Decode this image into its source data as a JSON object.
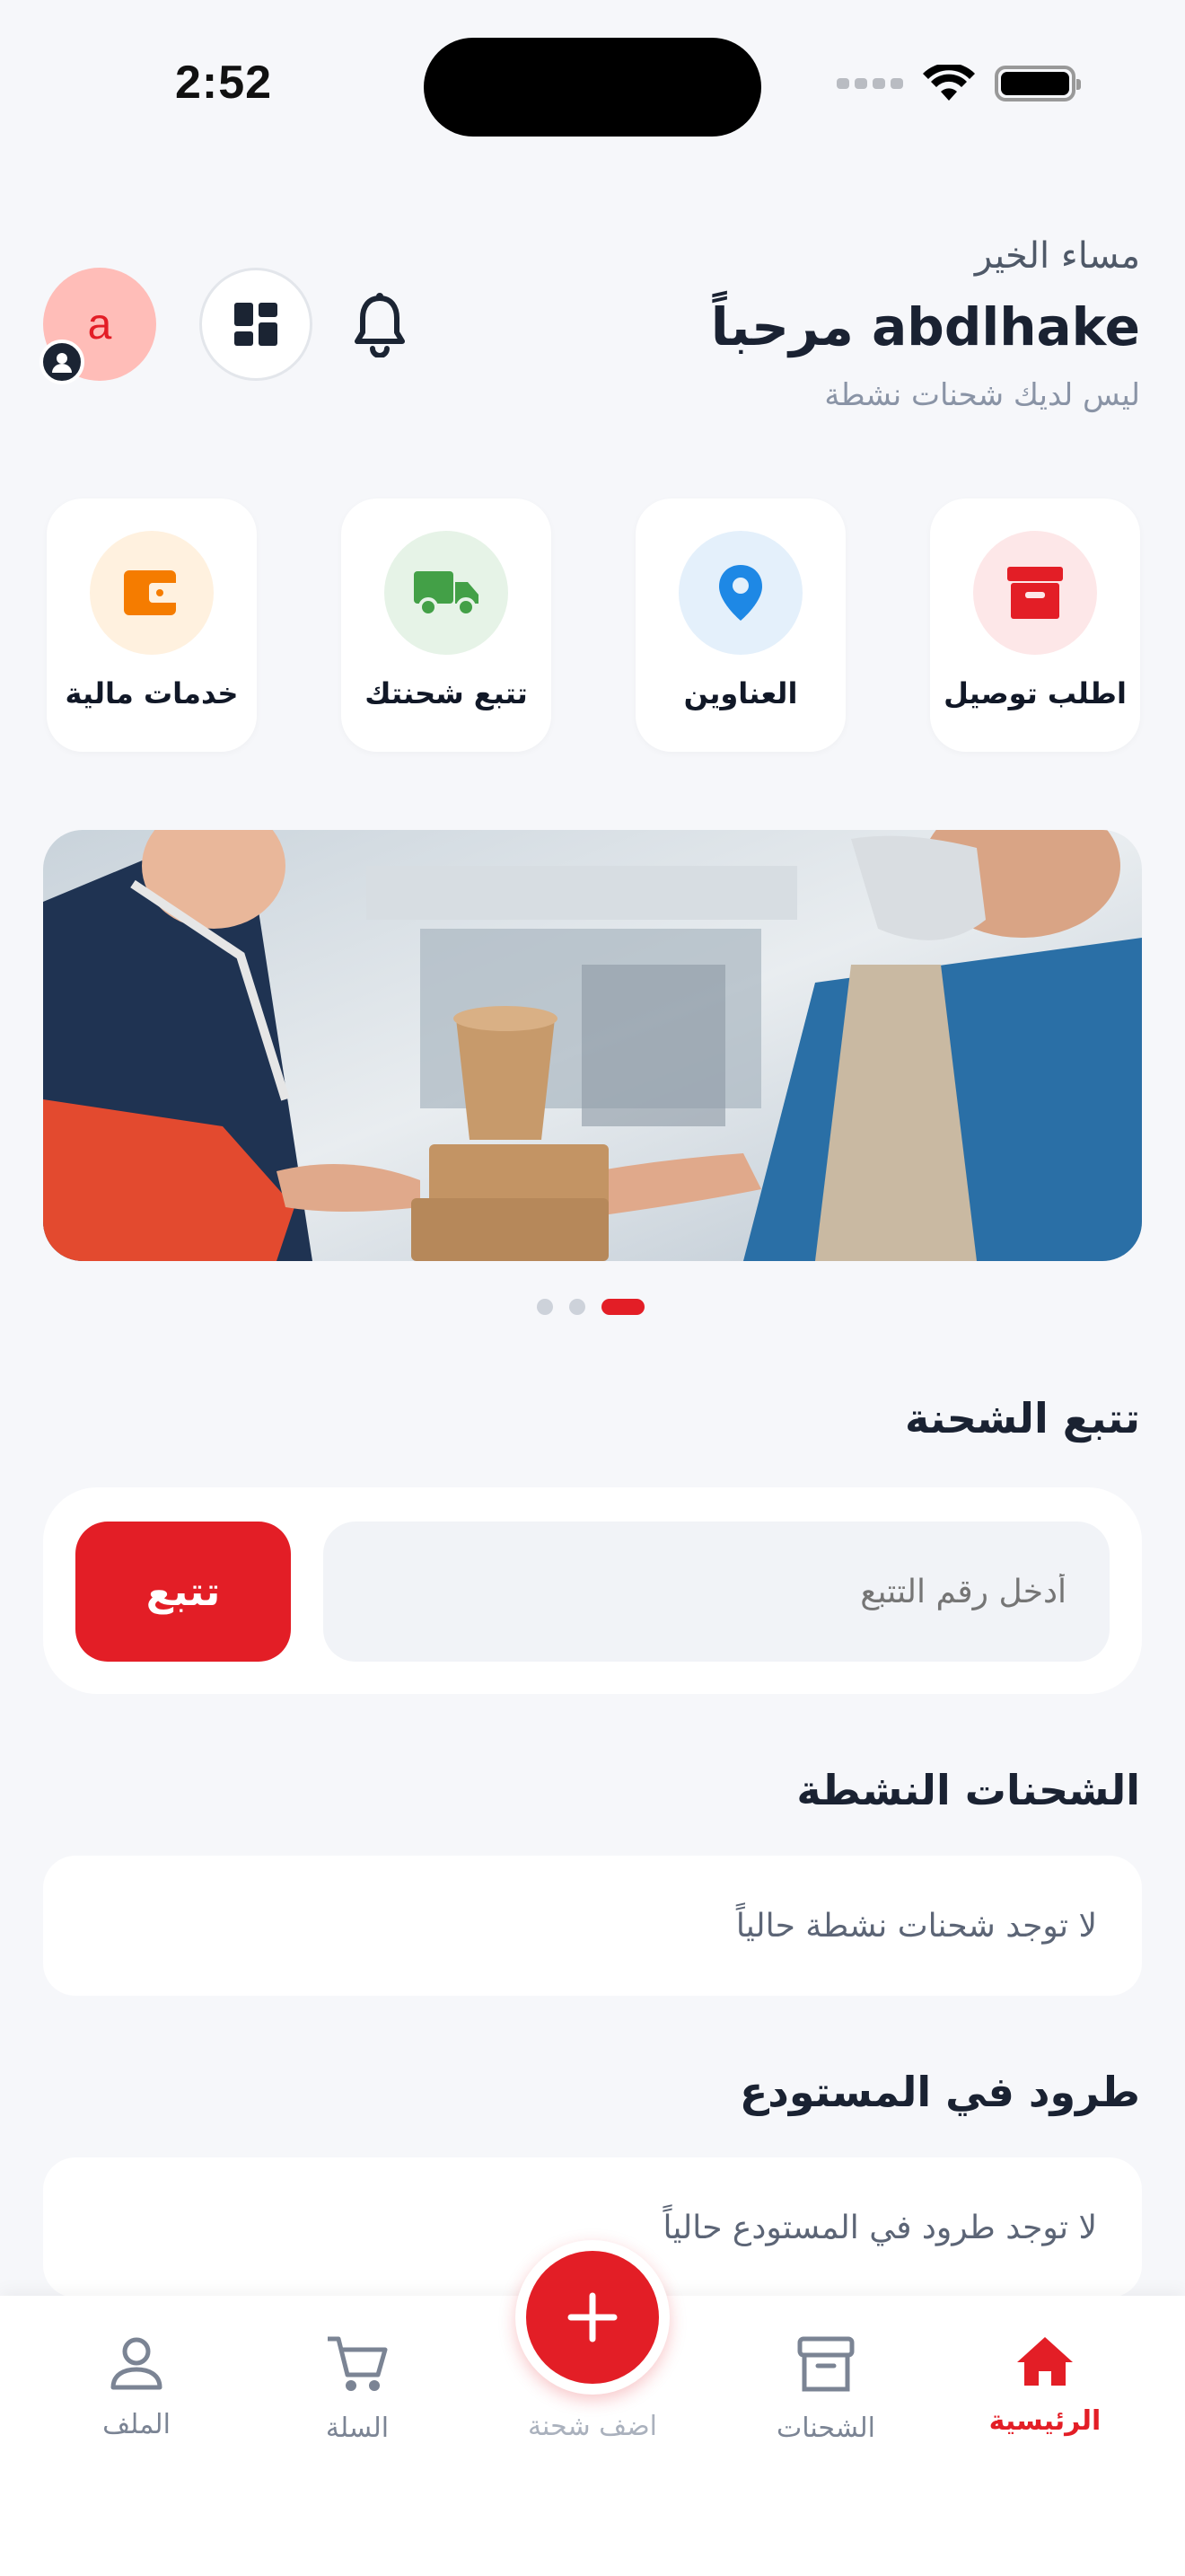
{
  "status_bar": {
    "time": "2:52"
  },
  "header": {
    "greeting": "مساء الخير",
    "welcome": "مرحباً abdlhake",
    "subtitle": "ليس لديك شحنات نشطة",
    "avatar_letter": "a"
  },
  "quick_actions": [
    {
      "label": "اطلب توصيل",
      "icon": "box-icon",
      "color": "#e31e26",
      "bg": "#fde7e8"
    },
    {
      "label": "العناوين",
      "icon": "location-pin-icon",
      "color": "#1e88e5",
      "bg": "#e4f0fb"
    },
    {
      "label": "تتبع شحنتك",
      "icon": "truck-icon",
      "color": "#43a047",
      "bg": "#e6f3e7"
    },
    {
      "label": "خدمات مالية",
      "icon": "wallet-icon",
      "color": "#f57c00",
      "bg": "#fff1df"
    }
  ],
  "banner": {
    "slide_count": 3,
    "active_slide": 3
  },
  "tracking": {
    "title": "تتبع الشحنة",
    "placeholder": "أدخل رقم التتبع",
    "button": "تتبع"
  },
  "active_shipments": {
    "title": "الشحنات النشطة",
    "empty_text": "لا توجد شحنات نشطة حالياً"
  },
  "warehouse": {
    "title": "طرود في المستودع",
    "empty_text": "لا توجد طرود في المستودع حالياً"
  },
  "bottom_nav": {
    "items": [
      {
        "label": "الرئيسية",
        "icon": "home-icon",
        "active": true
      },
      {
        "label": "الشحنات",
        "icon": "archive-box-icon",
        "active": false
      },
      {
        "label": "اضف شحنة",
        "icon": "plus-icon",
        "active": false
      },
      {
        "label": "السلة",
        "icon": "cart-icon",
        "active": false
      },
      {
        "label": "الملف",
        "icon": "user-icon",
        "active": false
      }
    ]
  },
  "colors": {
    "accent": "#e31e26",
    "background": "#f6f7fa",
    "text": "#1a2232"
  }
}
